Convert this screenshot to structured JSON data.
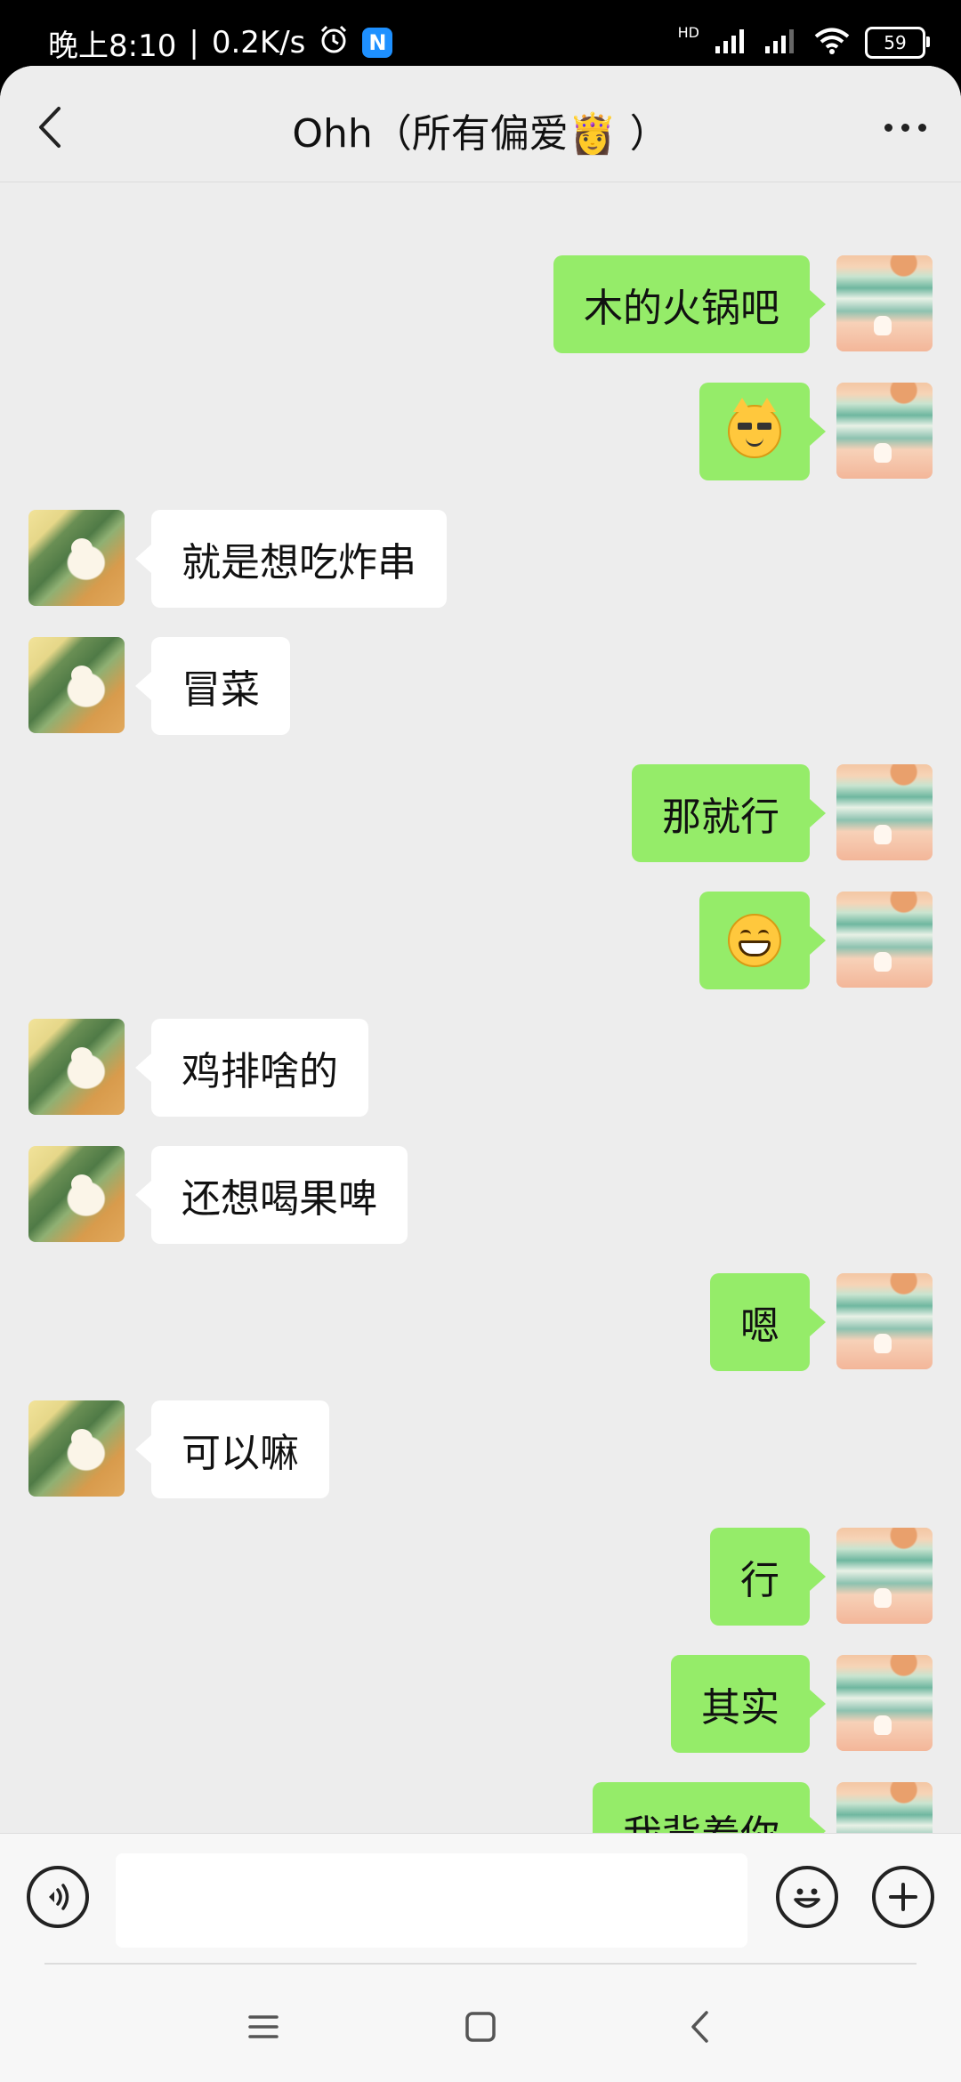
{
  "status_bar": {
    "time": "晚上8:10",
    "net_speed": "0.2K/s",
    "app_badge": "N",
    "hd_label": "HD",
    "battery": "59"
  },
  "header": {
    "title": "Ohh（所有偏爱👸 ）"
  },
  "messages": [
    {
      "sender": "me",
      "text": "木的火锅吧"
    },
    {
      "sender": "me",
      "emoji": "doge-cat-emoji"
    },
    {
      "sender": "them",
      "text": "就是想吃炸串"
    },
    {
      "sender": "them",
      "text": "冒菜"
    },
    {
      "sender": "me",
      "text": "那就行"
    },
    {
      "sender": "me",
      "emoji": "grin-emoji"
    },
    {
      "sender": "them",
      "text": "鸡排啥的"
    },
    {
      "sender": "them",
      "text": "还想喝果啤"
    },
    {
      "sender": "me",
      "text": "嗯"
    },
    {
      "sender": "them",
      "text": "可以嘛"
    },
    {
      "sender": "me",
      "text": "行"
    },
    {
      "sender": "me",
      "text": "其实"
    },
    {
      "sender": "me",
      "text": "我背着你"
    }
  ],
  "input": {
    "value": "",
    "placeholder": ""
  },
  "colors": {
    "my_bubble": "#95ec69",
    "their_bubble": "#ffffff",
    "background": "#ededed"
  }
}
